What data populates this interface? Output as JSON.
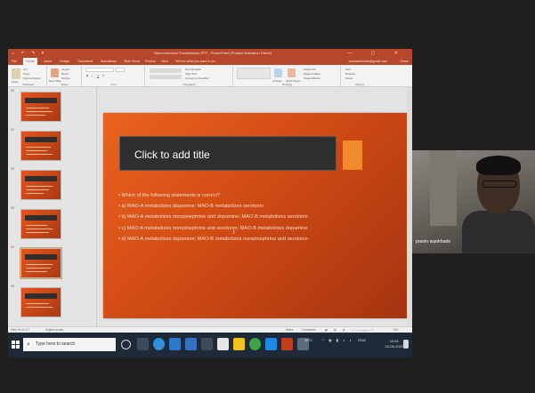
{
  "app": {
    "window_title": "Neurochemical Transmission PPT - PowerPoint (Product Activation Failed)",
    "quick_access": "⌂ ↶ ↷ ▾",
    "window_controls": "— ▢ ✕"
  },
  "ribbon_tabs": [
    "File",
    "Home",
    "Insert",
    "Design",
    "Transitions",
    "Animations",
    "Slide Show",
    "Review",
    "View",
    "Tell me what you want to do..."
  ],
  "account": {
    "user": "pravwankhade@gmail.com",
    "share": "Share"
  },
  "ribbon_groups": [
    {
      "label": "Clipboard",
      "items": [
        "Paste",
        "Cut",
        "Copy",
        "Format Painter"
      ]
    },
    {
      "label": "Slides",
      "items": [
        "New Slide",
        "Layout",
        "Reset",
        "Section"
      ]
    },
    {
      "label": "Font",
      "items": [
        "B",
        "I",
        "U",
        "S"
      ]
    },
    {
      "label": "Paragraph",
      "items": [
        "Text Direction",
        "Align Text",
        "Convert to SmartArt"
      ]
    },
    {
      "label": "Drawing",
      "items": [
        "Arrange",
        "Quick Styles",
        "Shape Fill",
        "Shape Outline",
        "Shape Effects"
      ]
    },
    {
      "label": "Editing",
      "items": [
        "Find",
        "Replace",
        "Select"
      ]
    }
  ],
  "thumbnails": [
    {
      "number": "90",
      "selected": false
    },
    {
      "number": "91",
      "selected": false
    },
    {
      "number": "92",
      "selected": false
    },
    {
      "number": "93",
      "selected": false
    },
    {
      "number": "94",
      "selected": true
    },
    {
      "number": "95",
      "selected": false
    }
  ],
  "slide": {
    "title_placeholder": "Click to add title",
    "bullets": [
      "• Which of the following statements is correct?",
      "• a) MAO-A metabolizes dopamine; MAO-B metabolizes serotonin",
      "• b) MAO-A metabolizes norepinephrine and dopamine; MAO-B metabolizes serotonin",
      "• c) MAO-A metabolizes norepinephrine and serotonin; MAO-B metabolizes dopamine",
      "• d) MAO-A metabolizes dopamine; MAO-B metabolizes norepinephrine and serotonin"
    ]
  },
  "status": {
    "slide_info": "Slide 94 of 117",
    "language": "English (India)",
    "notes": "Notes",
    "comments": "Comments",
    "zoom": "73%"
  },
  "taskbar": {
    "search_placeholder": "Type here to search",
    "weather": "28°C",
    "language": "ENG",
    "time": "13:45",
    "date": "24-09-2021"
  },
  "webcam": {
    "participant_name": "pravin wankhade"
  },
  "colors": {
    "ppt_red": "#b7472a",
    "slide_orange": "#e8641f",
    "slide_dark": "#2f2f2f",
    "taskbar": "#1e2a38"
  }
}
